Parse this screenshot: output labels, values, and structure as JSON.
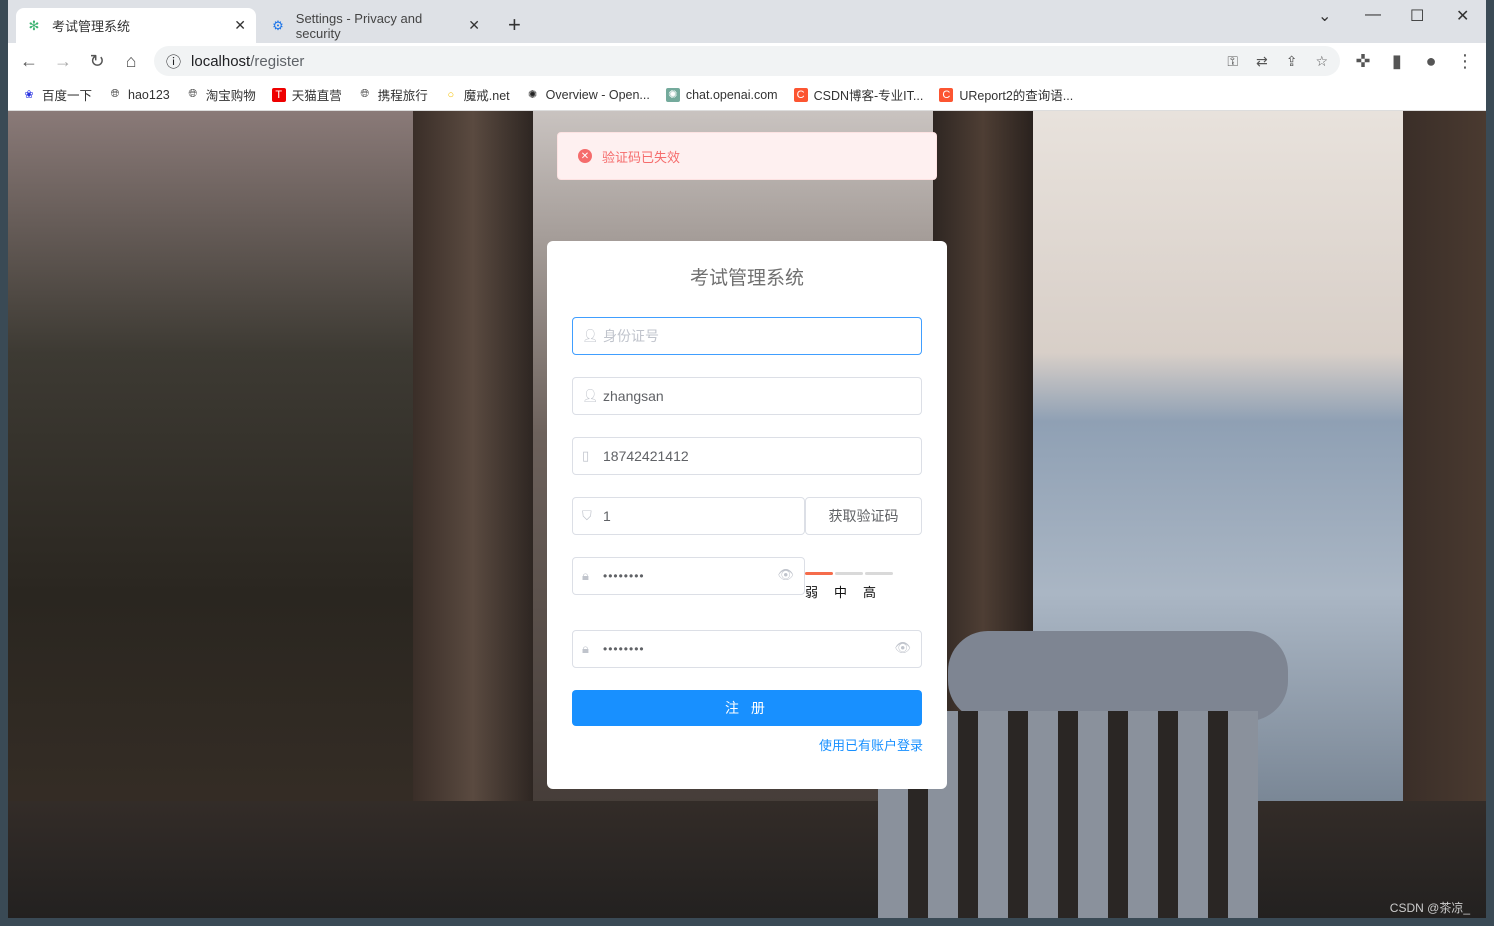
{
  "browser": {
    "tabs": [
      {
        "label": "考试管理系统",
        "active": true
      },
      {
        "label": "Settings - Privacy and security",
        "active": false
      }
    ],
    "url_host": "localhost",
    "url_path": "/register",
    "bookmarks": [
      "百度一下",
      "hao123",
      "淘宝购物",
      "天猫直营",
      "携程旅行",
      "魔戒.net",
      "Overview - Open...",
      "chat.openai.com",
      "CSDN博客-专业IT...",
      "UReport2的查询语..."
    ]
  },
  "alert": {
    "type": "error",
    "message": "验证码已失效"
  },
  "form": {
    "title": "考试管理系统",
    "id_card": {
      "value": "",
      "placeholder": "身份证号"
    },
    "username": {
      "value": "zhangsan"
    },
    "phone": {
      "value": "18742421412"
    },
    "code": {
      "value": "1"
    },
    "get_code_label": "获取验证码",
    "password": {
      "value": "••••••••"
    },
    "confirm_password": {
      "value": "••••••••"
    },
    "strength": {
      "labels": [
        "弱",
        "中",
        "高"
      ],
      "level": 1
    },
    "register_label": "注 册",
    "login_link": "使用已有账户登录"
  },
  "watermark": "CSDN @茶凉_",
  "colors": {
    "primary": "#1890ff",
    "error": "#f56c6c",
    "strength_weak": "#f56c4b"
  }
}
